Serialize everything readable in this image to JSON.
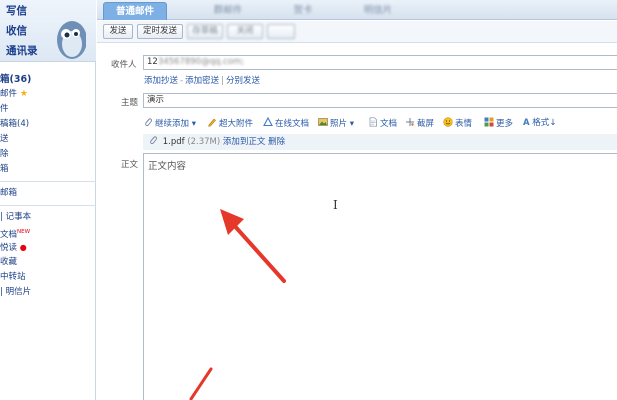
{
  "sidebar": {
    "top_links": [
      "写信",
      "收信",
      "通讯录"
    ],
    "folders": [
      {
        "label": "箱(36)",
        "bold": true
      },
      {
        "label": "邮件",
        "star": true
      },
      {
        "label": "件"
      },
      {
        "label": "稿箱(4)"
      },
      {
        "label": "送"
      },
      {
        "label": "除"
      },
      {
        "label": "箱"
      }
    ],
    "extra": {
      "label": "邮箱"
    },
    "tools": [
      {
        "label": "| 记事本"
      },
      {
        "label": "文档",
        "badge": "NEW"
      },
      {
        "label": "悦读",
        "dot": "●"
      },
      {
        "label": "收藏"
      },
      {
        "label": "中转站"
      },
      {
        "label": "| 明信片"
      }
    ]
  },
  "tabs": [
    {
      "label": "普通邮件",
      "active": true
    },
    {
      "label": "群邮件"
    },
    {
      "label": "贺卡"
    },
    {
      "label": "明信片"
    }
  ],
  "toolbar": {
    "buttons": [
      "发送",
      "定时发送",
      "存草稿",
      "关闭"
    ]
  },
  "compose": {
    "to_label": "收件人",
    "to_value_prefix": "12",
    "to_value_blur": "34567890@qq.com;",
    "sub_links": [
      "添加抄送",
      "添加密送",
      "分别发送"
    ],
    "subject_label": "主题",
    "subject_value": "演示",
    "body_label": "正文",
    "body_text": "正文内容"
  },
  "edit_toolbar": {
    "items": [
      "继续添加",
      "超大附件",
      "在线文档",
      "照片",
      "文档",
      "截屏",
      "表情",
      "更多",
      "格式"
    ]
  },
  "attachment": {
    "name": "1.pdf",
    "size": "(2.37M)",
    "actions": [
      "添加到正文",
      "删除"
    ]
  },
  "cursor_glyph": "I",
  "colors": {
    "accent": "#7eb0e6",
    "link": "#2a5aa8",
    "arrow": "#e5372a"
  }
}
